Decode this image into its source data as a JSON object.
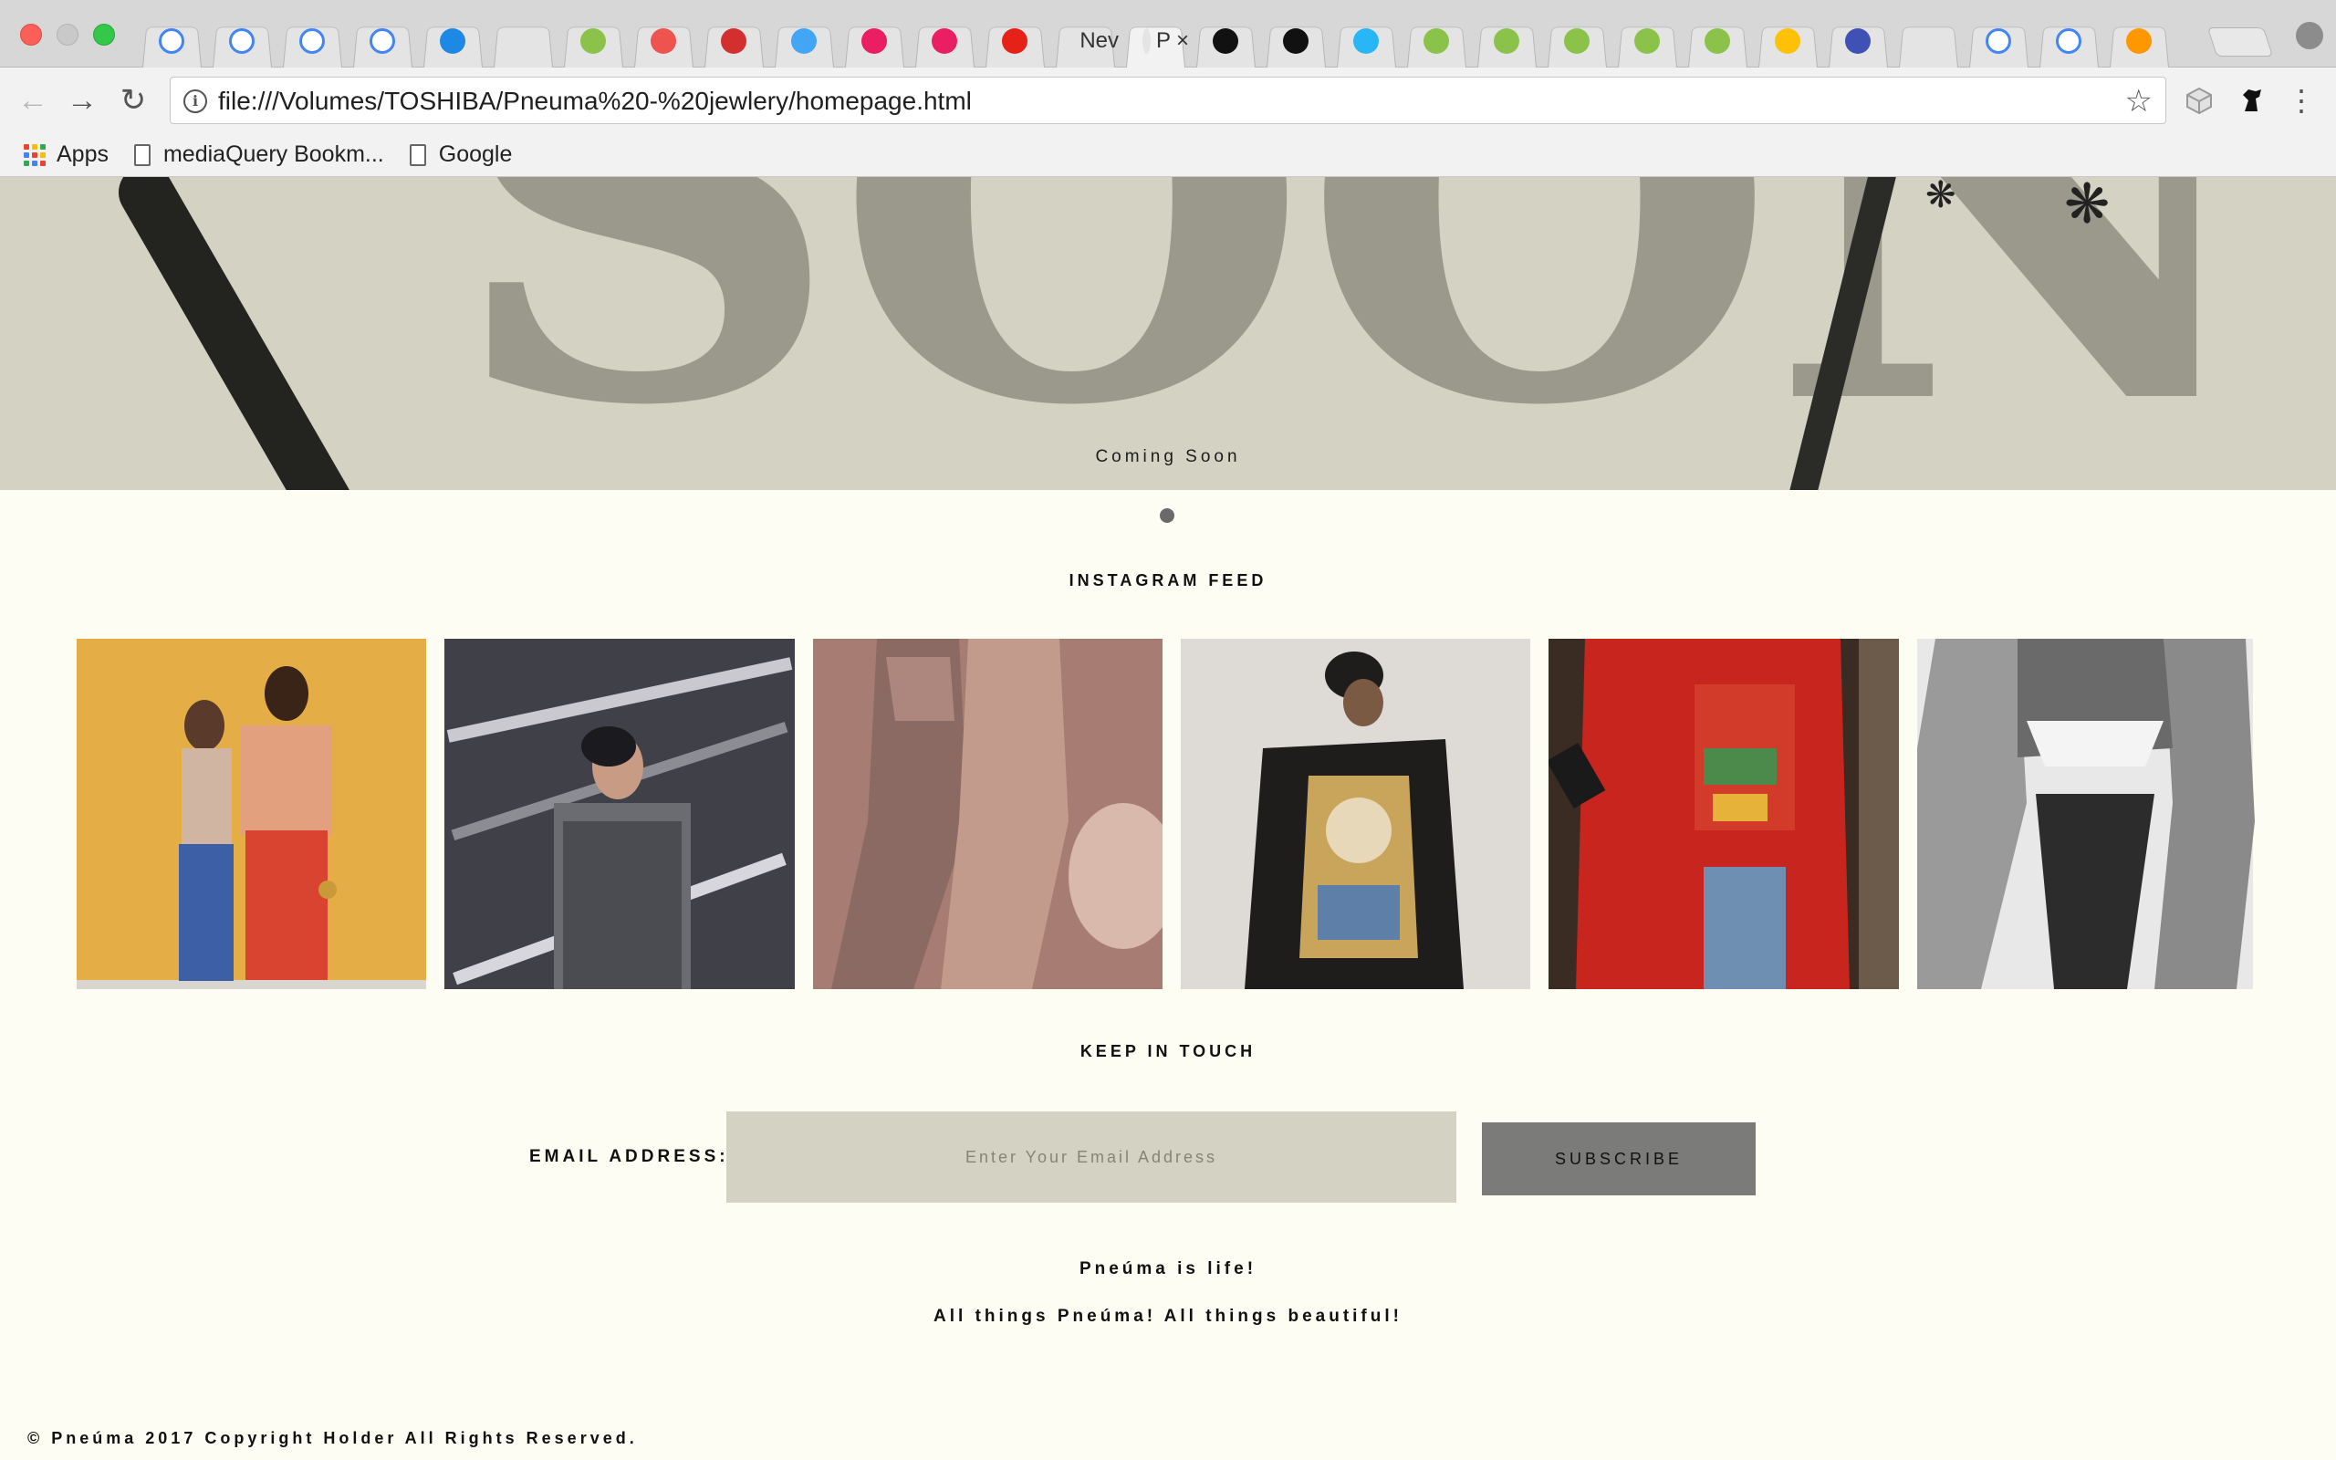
{
  "browser": {
    "tabs": [
      {
        "favicon": "google-icon",
        "title": "",
        "color": "#ffffff"
      },
      {
        "favicon": "google-icon",
        "title": "",
        "color": "#ffffff"
      },
      {
        "favicon": "google-icon",
        "title": "",
        "color": "#ffffff"
      },
      {
        "favicon": "document-icon",
        "title": "",
        "color": "#ffffff"
      },
      {
        "favicon": "x-app-icon",
        "title": "",
        "color": "#1e88e5"
      },
      {
        "favicon": "blank-icon",
        "title": "",
        "color": "#e4e4e4"
      },
      {
        "favicon": "w3schools-icon",
        "title": "",
        "color": "#8bc34a"
      },
      {
        "favicon": "f-app-icon",
        "title": "",
        "color": "#ef5350"
      },
      {
        "favicon": "fl-app-icon",
        "title": "",
        "color": "#d32f2f"
      },
      {
        "favicon": "globe-icon",
        "title": "",
        "color": "#42a5f5"
      },
      {
        "favicon": "heart-app-icon",
        "title": "",
        "color": "#e91e63"
      },
      {
        "favicon": "heart-app-icon",
        "title": "",
        "color": "#e91e63"
      },
      {
        "favicon": "youtube-icon",
        "title": "",
        "color": "#e62117"
      },
      {
        "favicon": "blank-icon",
        "title": "Nev",
        "color": "#e4e4e4"
      },
      {
        "favicon": "blank-icon",
        "title": "P",
        "color": "#e4e4e4",
        "active": true
      },
      {
        "favicon": "camera-app-icon",
        "title": "",
        "color": "#111111"
      },
      {
        "favicon": "b-app-icon",
        "title": "",
        "color": "#111111"
      },
      {
        "favicon": "photo-app-icon",
        "title": "",
        "color": "#29b6f6"
      },
      {
        "favicon": "w3schools-icon",
        "title": "",
        "color": "#8bc34a"
      },
      {
        "favicon": "w3schools-icon",
        "title": "",
        "color": "#8bc34a"
      },
      {
        "favicon": "w3schools-icon",
        "title": "",
        "color": "#8bc34a"
      },
      {
        "favicon": "w3schools-icon",
        "title": "",
        "color": "#8bc34a"
      },
      {
        "favicon": "w3schools-icon",
        "title": "",
        "color": "#8bc34a"
      },
      {
        "favicon": "note-app-icon",
        "title": "",
        "color": "#ffc107"
      },
      {
        "favicon": "grid-app-icon",
        "title": "",
        "color": "#3f51b5"
      },
      {
        "favicon": "blank-icon",
        "title": "",
        "color": "#e4e4e4"
      },
      {
        "favicon": "google-icon",
        "title": "",
        "color": "#ffffff"
      },
      {
        "favicon": "google-icon",
        "title": "",
        "color": "#ffffff"
      },
      {
        "favicon": "scissors-app-icon",
        "title": "",
        "color": "#ff9800"
      }
    ],
    "url": "file:///Volumes/TOSHIBA/Pneuma%20-%20jewlery/homepage.html",
    "bookmarks": [
      {
        "label": "Apps",
        "icon": "apps-grid-icon"
      },
      {
        "label": "mediaQuery Bookm...",
        "icon": "page-icon"
      },
      {
        "label": "Google",
        "icon": "page-icon"
      }
    ]
  },
  "hero": {
    "word": "SOON",
    "caption": "Coming Soon",
    "background": "#d4d2c2"
  },
  "instagram": {
    "title": "INSTAGRAM FEED",
    "photos": [
      {
        "name": "two-models-yellow-backdrop-photo",
        "palette": [
          "#e4ad45",
          "#d8442f",
          "#3d5fa6"
        ]
      },
      {
        "name": "model-sequin-jacket-photo",
        "palette": [
          "#3f4048",
          "#c9c9cf",
          "#8c8d93"
        ]
      },
      {
        "name": "embellished-gowns-photo",
        "palette": [
          "#b88b82",
          "#d9b9ab",
          "#8a6a63"
        ]
      },
      {
        "name": "printed-jacket-photo",
        "palette": [
          "#dedbd7",
          "#1e1d1c",
          "#c9a55c"
        ]
      },
      {
        "name": "red-coat-street-style-photo",
        "palette": [
          "#c8251f",
          "#3a2c22",
          "#4b8a4a"
        ]
      },
      {
        "name": "black-white-figure-photo",
        "palette": [
          "#e8e8e8",
          "#2c2c2c",
          "#9a9a9a"
        ]
      }
    ]
  },
  "newsletter": {
    "title": "KEEP IN TOUCH",
    "label": "EMAIL ADDRESS:",
    "placeholder": "Enter Your Email Address",
    "button": "SUBSCRIBE"
  },
  "taglines": {
    "line1": "Pneúma is life!",
    "line2": "All things Pneúma! All things beautiful!"
  },
  "footer": {
    "copyright": "© Pneúma 2017 Copyright Holder All Rights Reserved."
  }
}
